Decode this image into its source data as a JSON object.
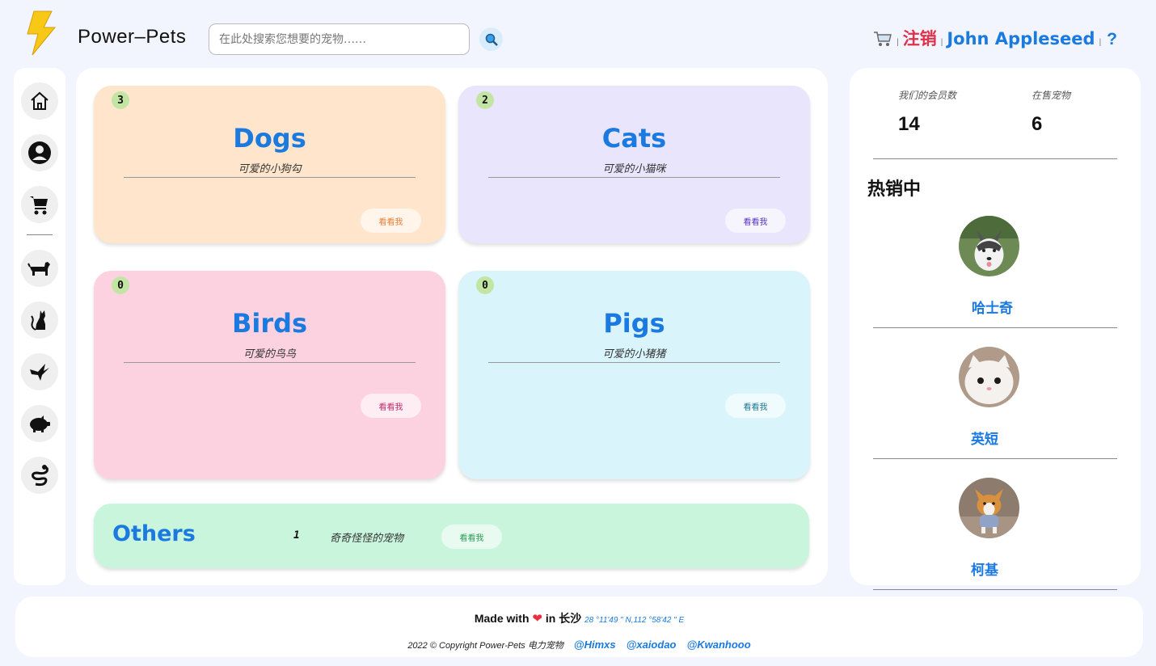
{
  "header": {
    "brand": "Power–Pets",
    "search_placeholder": "在此处搜索您想要的宠物……",
    "logout": "注销",
    "user": "John Appleseed",
    "help": "?"
  },
  "sidebar": {
    "items": [
      "home-icon",
      "account-icon",
      "cart-icon",
      "dog-icon",
      "cat-icon",
      "bird-icon",
      "pig-icon",
      "snake-icon"
    ]
  },
  "categories": [
    {
      "title": "Dogs",
      "subtitle": "可爱的小狗勾",
      "count": "3",
      "button": "看看我",
      "bg": "#fee5cb",
      "btn_color": "#e8803a"
    },
    {
      "title": "Cats",
      "subtitle": "可爱的小猫咪",
      "count": "2",
      "button": "看看我",
      "bg": "#e8e5fc",
      "btn_color": "#5a35c8"
    },
    {
      "title": "Birds",
      "subtitle": "可爱的鸟鸟",
      "count": "0",
      "button": "看看我",
      "bg": "#fdd2e0",
      "btn_color": "#c02e6e"
    },
    {
      "title": "Pigs",
      "subtitle": "可爱的小猪猪",
      "count": "0",
      "button": "看看我",
      "bg": "#d9f4fb",
      "btn_color": "#247a96"
    }
  ],
  "others": {
    "title": "Others",
    "count": "1",
    "subtitle": "奇奇怪怪的宠物",
    "button": "看看我"
  },
  "stats": {
    "members_label": "我们的会员数",
    "members": "14",
    "pets_label": "在售宠物",
    "pets": "6"
  },
  "hot": {
    "title": "热销中",
    "items": [
      {
        "name": "哈士奇"
      },
      {
        "name": "英短"
      },
      {
        "name": "柯基"
      }
    ]
  },
  "footer": {
    "made_with": "Made with",
    "in_city": "in 长沙",
    "coords": "28 °11'49 \" N,112 °58'42 \" E",
    "copyright": "2022 © Copyright Power-Pets 电力宠物",
    "links": [
      "@Himxs",
      "@xaiodao",
      "@Kwanhooo"
    ]
  },
  "colors": {
    "accent": "#1a7ae0",
    "logout": "#e0304a",
    "badge": "#c3e5a4"
  }
}
